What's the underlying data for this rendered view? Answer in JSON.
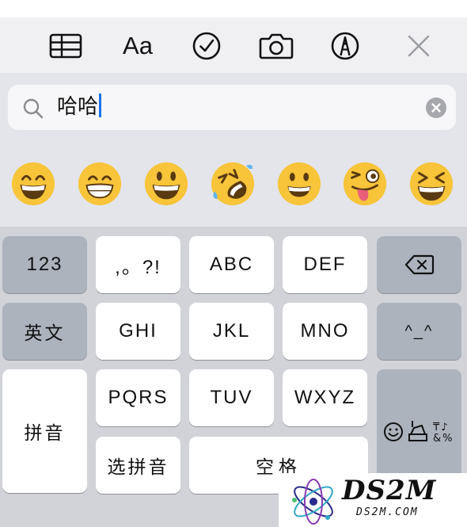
{
  "toolbar": {
    "icons": [
      "table-icon",
      "text-format-icon",
      "checkmark-circle-icon",
      "camera-icon",
      "pen-markup-icon",
      "close-icon"
    ],
    "text_format_label": "Aa"
  },
  "search": {
    "value": "哈哈",
    "icons": [
      "search-icon",
      "clear-icon"
    ]
  },
  "emoji_results": [
    "😄",
    "😁",
    "😃",
    "🤣",
    "😀",
    "😜",
    "😆"
  ],
  "keyboard": {
    "numbers_key": "123",
    "punct_key": ",。?!",
    "abc_key": "ABC",
    "def_key": "DEF",
    "delete_key_icon": "backspace-icon",
    "english_key": "英文",
    "ghi_key": "GHI",
    "jkl_key": "JKL",
    "mno_key": "MNO",
    "kaomoji_key": "^_^",
    "pinyin_key": "拼音",
    "pqrs_key": "PQRS",
    "tuv_key": "TUV",
    "wxyz_key": "WXYZ",
    "emoji_switch_icon": "emoji-symbols-icon",
    "select_pinyin_key": "选拼音",
    "space_key": "空格"
  },
  "watermark": {
    "title": "DS2M",
    "subtitle": "DS2M.COM"
  },
  "colors": {
    "caret": "#1a73e8",
    "keyboard_bg": "#d1d3d9",
    "function_key": "#adb3bd",
    "letter_key": "#ffffff",
    "emoji_face": "#f7c43a"
  }
}
